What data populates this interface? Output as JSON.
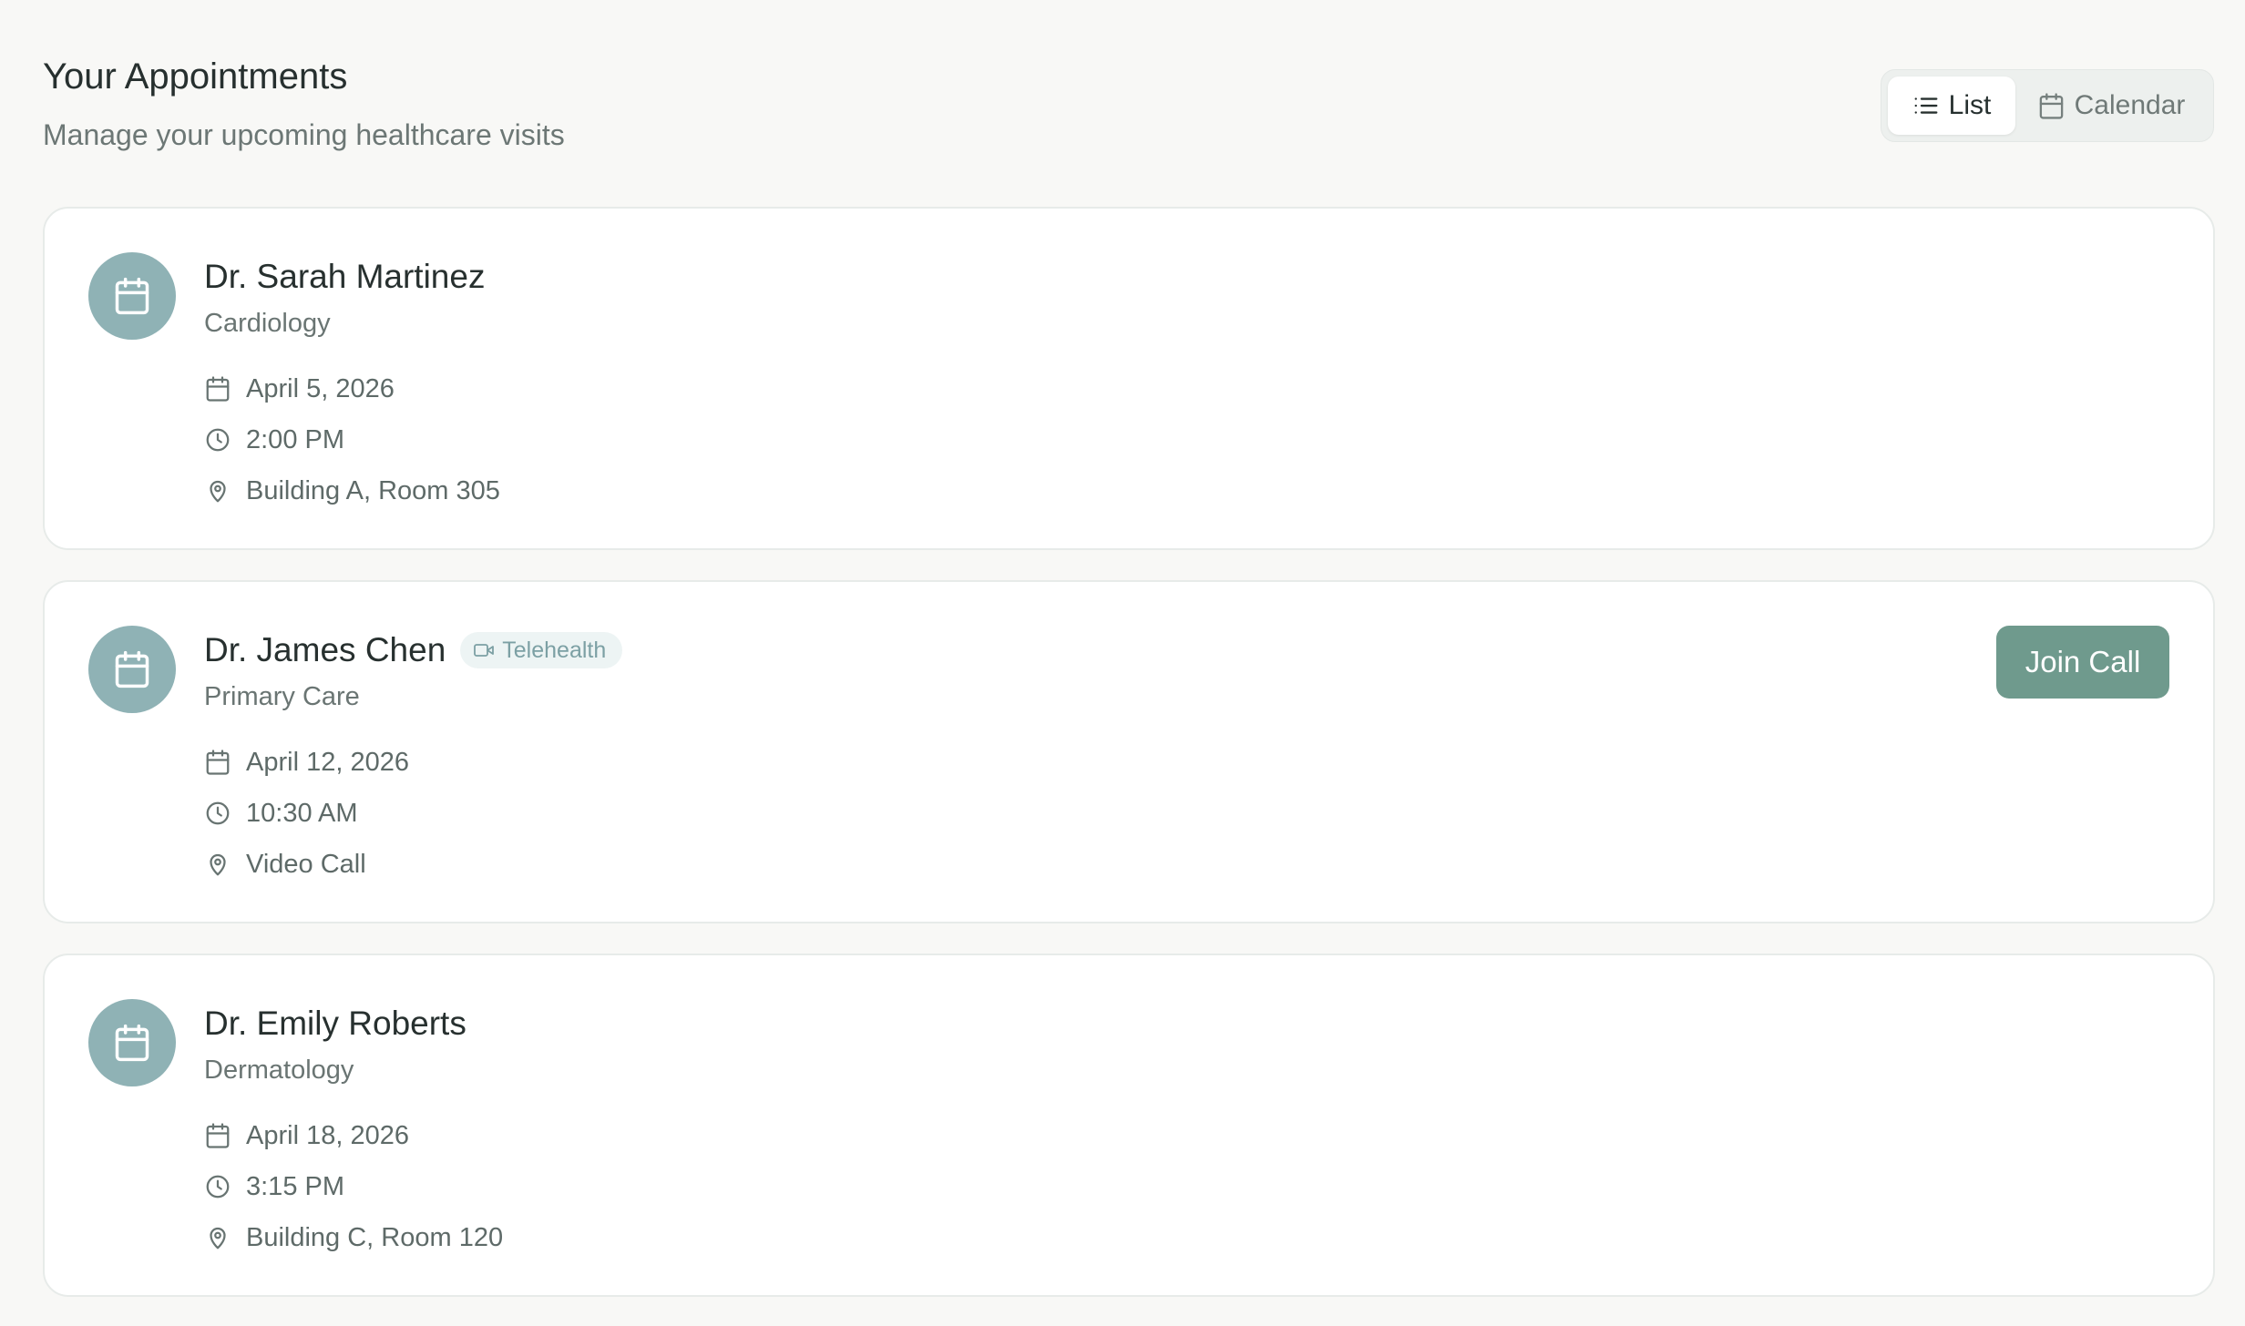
{
  "header": {
    "title": "Your Appointments",
    "subtitle": "Manage your upcoming healthcare visits"
  },
  "view_toggle": {
    "list_label": "List",
    "calendar_label": "Calendar",
    "active": "List",
    "list_icon": "list-icon",
    "calendar_icon": "calendar-icon"
  },
  "appointments": [
    {
      "doctor": "Dr. Sarah Martinez",
      "specialty": "Cardiology",
      "date": "April 5, 2026",
      "time": "2:00 PM",
      "location": "Building A, Room 305",
      "badge": null,
      "action": null
    },
    {
      "doctor": "Dr. James Chen",
      "specialty": "Primary Care",
      "date": "April 12, 2026",
      "time": "10:30 AM",
      "location": "Video Call",
      "badge": "Telehealth",
      "action": "Join Call"
    },
    {
      "doctor": "Dr. Emily Roberts",
      "specialty": "Dermatology",
      "date": "April 18, 2026",
      "time": "3:15 PM",
      "location": "Building C, Room 120",
      "badge": null,
      "action": null
    }
  ],
  "colors": {
    "page_background": "#f8f8f6",
    "card_background": "#ffffff",
    "avatar_background": "#8fb2b5",
    "accent_button": "#6f9a8d",
    "badge_background": "#edf4f4",
    "badge_text": "#7ca0a4",
    "primary_text": "#27302f",
    "secondary_text": "#6a7573"
  }
}
